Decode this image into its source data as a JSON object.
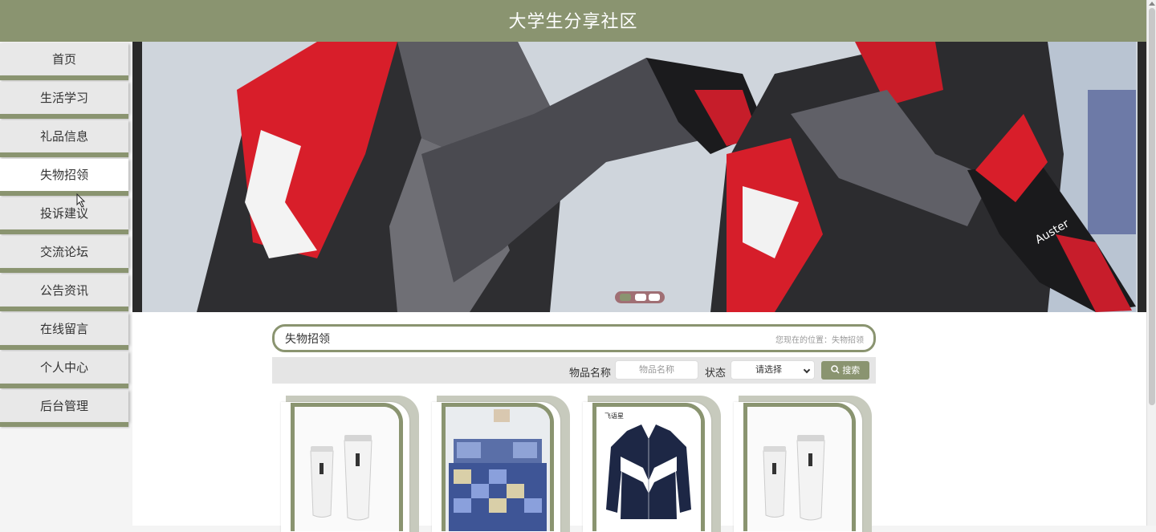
{
  "header": {
    "title": "大学生分享社区"
  },
  "sidebar": {
    "items": [
      {
        "label": "首页"
      },
      {
        "label": "生活学习"
      },
      {
        "label": "礼品信息"
      },
      {
        "label": "失物招领",
        "active": true
      },
      {
        "label": "投诉建议"
      },
      {
        "label": "交流论坛"
      },
      {
        "label": "公告资讯"
      },
      {
        "label": "在线留言"
      },
      {
        "label": "个人中心"
      },
      {
        "label": "后台管理"
      }
    ]
  },
  "banner": {
    "image": "speed-skaters-photo",
    "slides": 3,
    "active_slide": 1,
    "glove_text": "Auster"
  },
  "section": {
    "title": "失物招领",
    "location": "您现在的位置：失物招领"
  },
  "search": {
    "name_label": "物品名称",
    "name_placeholder": "物品名称",
    "status_label": "状态",
    "status_value": "请选择",
    "button_label": "搜索"
  },
  "products": [
    {
      "image": "tumbler-cups"
    },
    {
      "image": "bedding-set"
    },
    {
      "image": "track-jacket",
      "image_caption": "飞语星"
    },
    {
      "image": "tumbler-cups"
    }
  ],
  "colors": {
    "theme": "#8a9470",
    "nav_bg": "#e8e8e8",
    "nav_active_bg": "#ffffff",
    "carousel_dots": "#a06f74"
  }
}
